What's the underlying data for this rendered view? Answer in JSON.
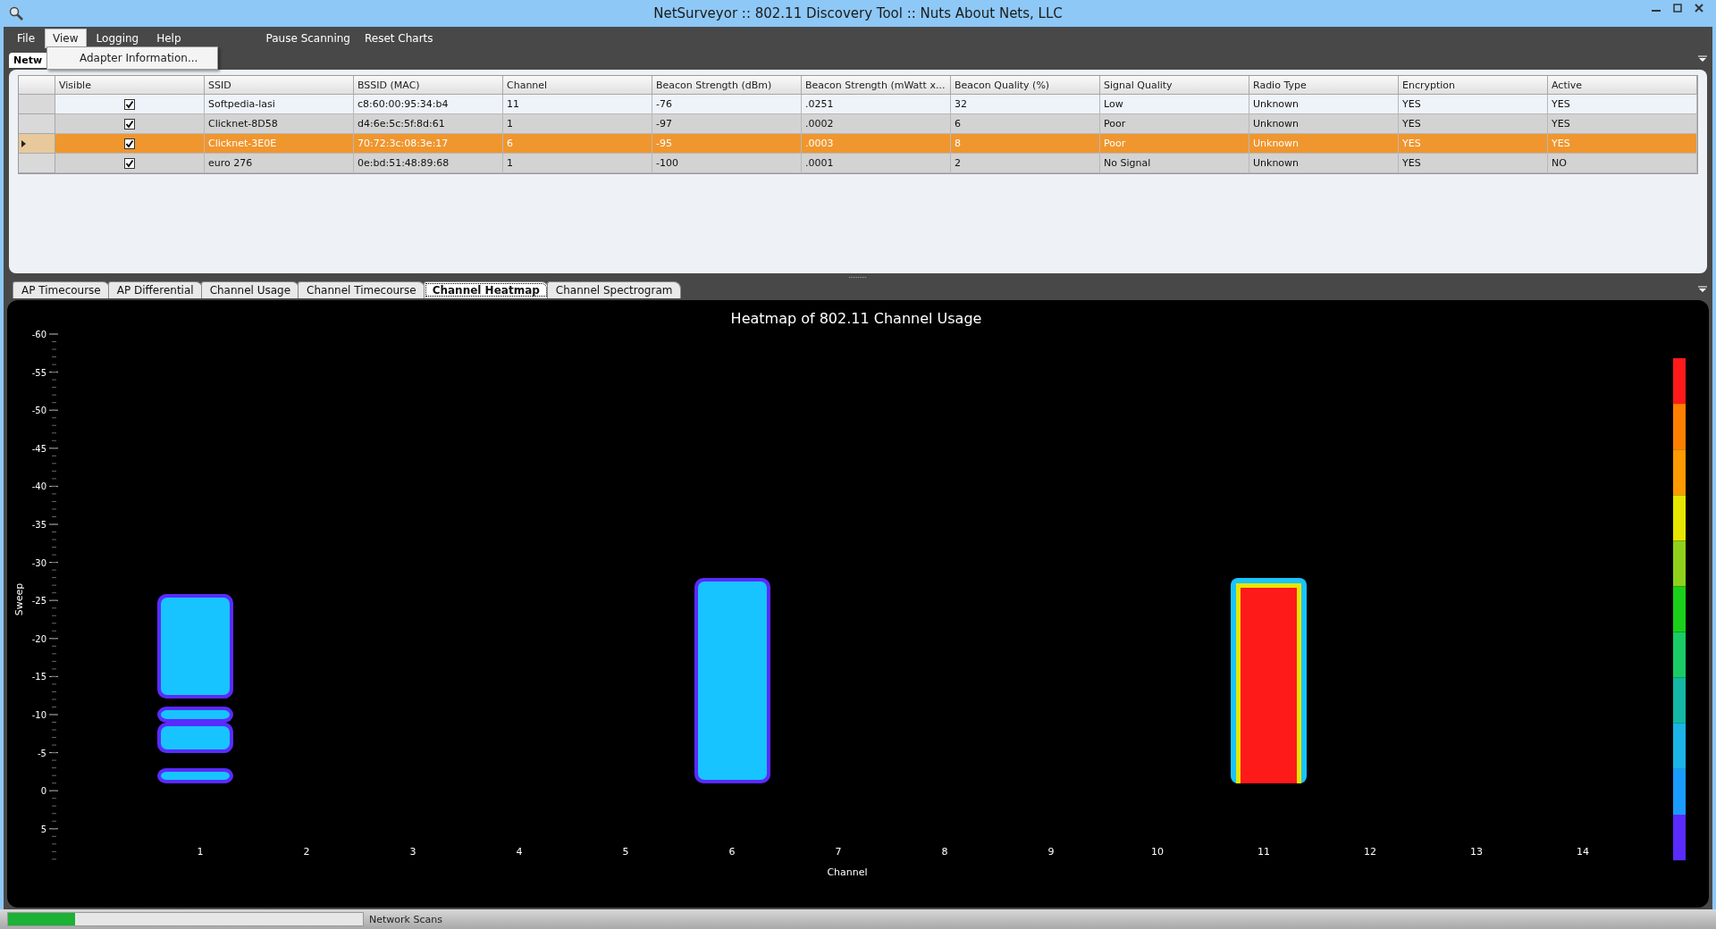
{
  "window": {
    "title": "NetSurveyor :: 802.11 Discovery Tool :: Nuts About Nets, LLC"
  },
  "menu": [
    {
      "label": "File",
      "selected": false
    },
    {
      "label": "View",
      "selected": true
    },
    {
      "label": "Logging",
      "selected": false
    },
    {
      "label": "Help",
      "selected": false
    }
  ],
  "toolbar_actions": [
    "Pause Scanning",
    "Reset Charts"
  ],
  "open_menu": {
    "items": [
      "Adapter Information..."
    ]
  },
  "top_tabs": [
    {
      "label": "Netw",
      "selected": true
    }
  ],
  "table": {
    "columns": [
      "Visible",
      "SSID",
      "BSSID (MAC)",
      "Channel",
      "Beacon Strength (dBm)",
      "Beacon Strength  (mWatt x...",
      "Beacon Quality (%)",
      "Signal Quality",
      "Radio Type",
      "Encryption",
      "Active"
    ],
    "rows": [
      {
        "visible": true,
        "selected": false,
        "cells": [
          "",
          "Softpedia-lasi",
          "c8:60:00:95:34:b4",
          "11",
          "-76",
          ".0251",
          "32",
          "Low",
          "Unknown",
          "YES",
          "YES"
        ]
      },
      {
        "visible": true,
        "selected": false,
        "cells": [
          "",
          "Clicknet-8D58",
          "d4:6e:5c:5f:8d:61",
          "1",
          "-97",
          ".0002",
          "6",
          "Poor",
          "Unknown",
          "YES",
          "YES"
        ]
      },
      {
        "visible": true,
        "selected": true,
        "cells": [
          "",
          "Clicknet-3E0E",
          "70:72:3c:08:3e:17",
          "6",
          "-95",
          ".0003",
          "8",
          "Poor",
          "Unknown",
          "YES",
          "YES"
        ]
      },
      {
        "visible": true,
        "selected": false,
        "cells": [
          "",
          "euro 276",
          "0e:bd:51:48:89:68",
          "1",
          "-100",
          ".0001",
          "2",
          "No Signal",
          "Unknown",
          "YES",
          "NO"
        ]
      }
    ]
  },
  "chart_tabs": [
    {
      "label": "AP Timecourse",
      "selected": false
    },
    {
      "label": "AP Differential",
      "selected": false
    },
    {
      "label": "Channel Usage",
      "selected": false
    },
    {
      "label": "Channel Timecourse",
      "selected": false
    },
    {
      "label": "Channel Heatmap",
      "selected": true
    },
    {
      "label": "Channel Spectrogram",
      "selected": false
    }
  ],
  "heatmap": {
    "title": "Heatmap of 802.11 Channel Usage",
    "ylabel": "Sweep",
    "xlabel": "Channel",
    "yticks": [
      "-60",
      "-55",
      "-50",
      "-45",
      "-40",
      "-35",
      "-30",
      "-25",
      "-20",
      "-15",
      "-10",
      "-5",
      "0",
      "5"
    ],
    "xticks": [
      "1",
      "2",
      "3",
      "4",
      "5",
      "6",
      "7",
      "8",
      "9",
      "10",
      "11",
      "12",
      "13",
      "14"
    ]
  },
  "status_bar": {
    "level": 0.19,
    "label": "Network Scans"
  }
}
